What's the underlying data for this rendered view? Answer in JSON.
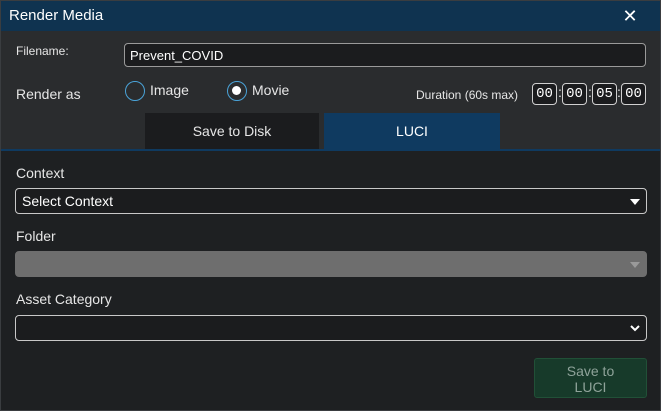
{
  "window": {
    "title": "Render Media",
    "close_glyph": "✕"
  },
  "filename": {
    "label": "Filename:",
    "value": "Prevent_COVID"
  },
  "render": {
    "label": "Render as",
    "options": [
      {
        "label": "Image",
        "selected": false
      },
      {
        "label": "Movie",
        "selected": true
      }
    ]
  },
  "duration": {
    "label": "Duration (60s max)",
    "parts": [
      "00",
      "00",
      "05",
      "00"
    ],
    "separator": ":"
  },
  "tabs": {
    "disk": "Save to Disk",
    "luci": "LUCI",
    "active": "luci"
  },
  "fields": {
    "context": {
      "label": "Context",
      "value": "Select Context"
    },
    "folder": {
      "label": "Folder",
      "value": ""
    },
    "asset": {
      "label": "Asset Category",
      "value": ""
    }
  },
  "save_button": {
    "label": "Save to\nLUCI"
  },
  "colors": {
    "titlebar": "#0f3350",
    "accent": "#4aa3d8",
    "active_tab": "#0f3a60",
    "save_button": "#173a2a"
  }
}
